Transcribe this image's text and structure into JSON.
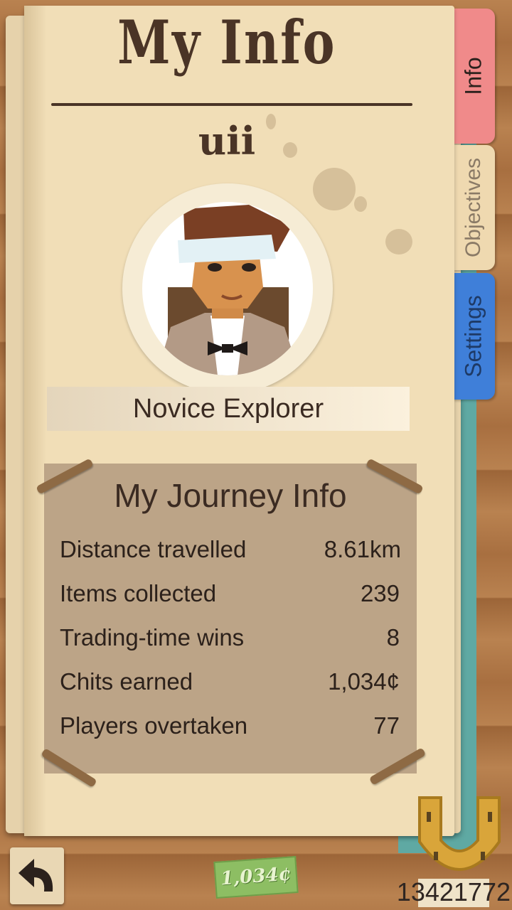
{
  "header": {
    "title": "My Info",
    "username": "uii"
  },
  "profile": {
    "rank": "Novice Explorer"
  },
  "journey": {
    "title": "My Journey Info",
    "stats": [
      {
        "label": "Distance travelled",
        "value": "8.61km"
      },
      {
        "label": "Items collected",
        "value": "239"
      },
      {
        "label": "Trading-time wins",
        "value": "8"
      },
      {
        "label": "Chits earned",
        "value": "1,034¢"
      },
      {
        "label": "Players overtaken",
        "value": "77"
      }
    ]
  },
  "tabs": [
    {
      "label": "Info",
      "color": "#f08a8a",
      "active": true
    },
    {
      "label": "Objectives",
      "color": "#f1deb7",
      "active": false
    },
    {
      "label": "Settings",
      "color": "#3f7fd9",
      "active": false
    }
  ],
  "footer": {
    "chits": "1,034¢",
    "points": "13421772",
    "back_icon": "back-arrow-icon",
    "horseshoe_icon": "horseshoe-icon"
  }
}
